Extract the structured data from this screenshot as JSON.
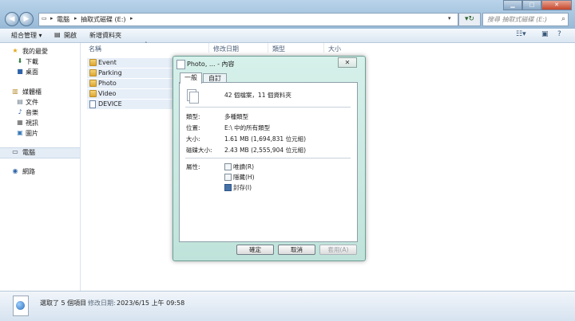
{
  "address": {
    "breadcrumbs": [
      "電腦",
      "抽取式磁碟 (E:)"
    ],
    "search_placeholder": "搜尋 抽取式磁碟 (E:)"
  },
  "toolbar": {
    "organize": "組合管理 ▾",
    "open": "開啟",
    "new_folder": "新增資料夾"
  },
  "sidebar": {
    "favorites": "我的最愛",
    "downloads": "下載",
    "desktop": "桌面",
    "libraries": "媒體櫃",
    "documents": "文件",
    "music": "音樂",
    "videos": "視訊",
    "pictures": "圖片",
    "computer": "電腦",
    "network": "網路"
  },
  "columns": {
    "name": "名稱",
    "modified": "修改日期",
    "type": "類型",
    "size": "大小"
  },
  "files": [
    {
      "name": "Event",
      "icon": "folder-icon"
    },
    {
      "name": "Parking",
      "icon": "folder-icon"
    },
    {
      "name": "Photo",
      "icon": "folder-icon"
    },
    {
      "name": "Video",
      "icon": "folder-icon"
    },
    {
      "name": "DEVICE",
      "icon": "file-icon"
    }
  ],
  "status": {
    "selected": "選取了 5 個項目",
    "modified_label": "修改日期:",
    "modified_value": "2023/6/15 上午 09:58"
  },
  "dialog": {
    "title": "Photo, ... - 內容",
    "tabs": [
      "一般",
      "自訂"
    ],
    "summary": "42 個檔案，11 個資料夾",
    "type_label": "類型:",
    "type_value": "多種類型",
    "location_label": "位置:",
    "location_value": "E:\\ 中的所有類型",
    "size_label": "大小:",
    "size_value": "1.61 MB (1,694,831 位元組)",
    "disk_size_label": "磁碟大小:",
    "disk_size_value": "2.43 MB (2,555,904 位元組)",
    "attributes_label": "屬性:",
    "attr_readonly": "唯讀(R)",
    "attr_hidden": "隱藏(H)",
    "attr_archive": "封存(I)",
    "ok": "確定",
    "cancel": "取消",
    "apply": "套用(A)"
  }
}
